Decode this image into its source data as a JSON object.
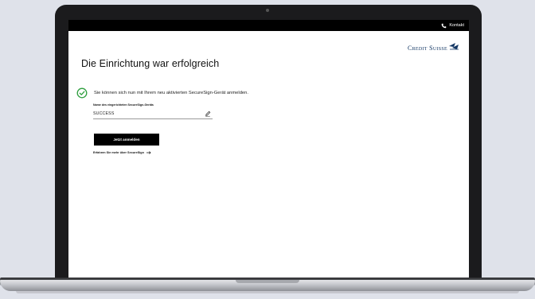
{
  "topbar": {
    "contact_label": "Kontakt",
    "contact_icon": "phone-icon"
  },
  "logo": {
    "text": "Credit Suisse",
    "icon": "sails-logo-icon",
    "color": "#123663"
  },
  "page": {
    "title": "Die Einrichtung war erfolgreich"
  },
  "success": {
    "icon": "check-circle-icon",
    "icon_color": "#2e9e3e",
    "message": "Sie können sich nun mit Ihrem neu aktivierten SecureSign-Gerät anmelden."
  },
  "device": {
    "label": "Name des eingerichteten SecureSign-Geräts",
    "value": "SUCCESS",
    "edit_icon": "pencil-icon"
  },
  "actions": {
    "login_button": "Jetzt anmelden",
    "learn_more": "Erfahren Sie mehr über SecureSign",
    "learn_more_icon": "arrow-right-icon"
  }
}
